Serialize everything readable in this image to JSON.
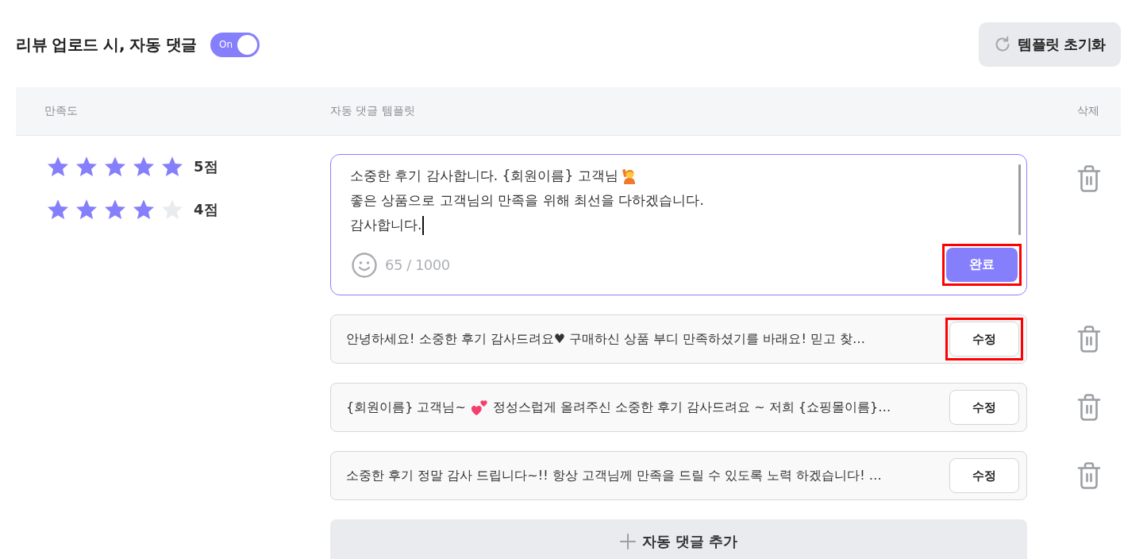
{
  "header": {
    "title": "리뷰 업로드 시, 자동 댓글",
    "toggle": {
      "label": "On",
      "on": true
    },
    "reset_button": "템플릿 초기화"
  },
  "table": {
    "columns": [
      "만족도",
      "자동 댓글 템플릿",
      "삭제"
    ],
    "ratings": [
      {
        "stars": 5,
        "label": "5점"
      },
      {
        "stars": 4,
        "label": "4점"
      }
    ],
    "templates": [
      {
        "kind": "editor",
        "focused": true,
        "lines": [
          {
            "segments": [
              {
                "kind": "text",
                "text": "소중한 후기 감사합니다. {회원이름} 고객님"
              },
              {
                "kind": "person"
              }
            ]
          },
          {
            "segments": [
              {
                "kind": "text",
                "text": "좋은 상품으로 고객님의 만족을 위해 최선을 다하겠습니다."
              }
            ]
          },
          {
            "segments": [
              {
                "kind": "text",
                "text": "감사합니다."
              }
            ]
          }
        ],
        "counter": "65 / 1000",
        "button": {
          "label": "완료",
          "highlighted": true
        }
      },
      {
        "kind": "row",
        "segments": [
          {
            "kind": "text",
            "text": "안녕하세요! 소중한 후기 감사드려요♥ 구매하신 상품 부디 만족하셨기를 바래요! 믿고 찾…"
          }
        ],
        "button": {
          "label": "수정",
          "highlighted": true
        }
      },
      {
        "kind": "row",
        "segments": [
          {
            "kind": "text",
            "text": "{회원이름} 고객님~"
          },
          {
            "kind": "hearts"
          },
          {
            "kind": "text",
            "text": "정성스럽게 올려주신 소중한 후기 감사드려요 ~ 저희 {쇼핑몰이름}…"
          }
        ],
        "button": {
          "label": "수정",
          "highlighted": false
        }
      },
      {
        "kind": "row",
        "segments": [
          {
            "kind": "text",
            "text": "소중한 후기 정말 감사 드립니다~!! 항상 고객님께 만족을 드릴 수 있도록 노력 하겠습니다! …"
          }
        ],
        "button": {
          "label": "수정",
          "highlighted": false
        }
      }
    ],
    "add_button": "자동 댓글 추가"
  }
}
